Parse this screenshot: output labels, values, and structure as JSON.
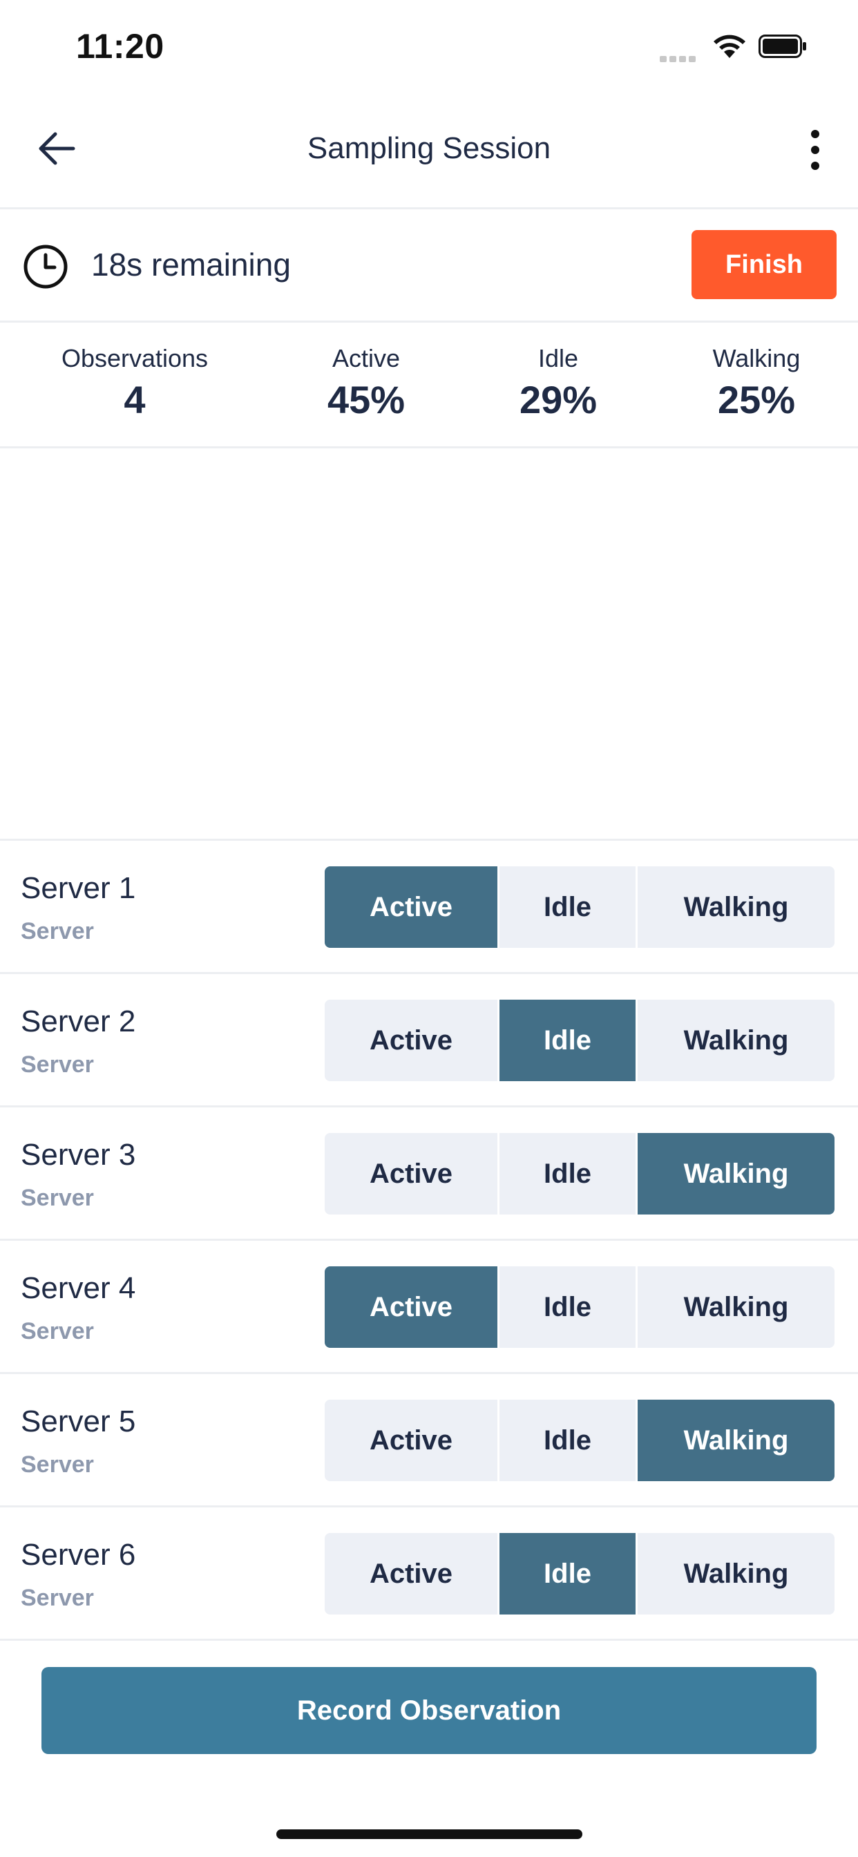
{
  "status_bar": {
    "time": "11:20"
  },
  "nav": {
    "title": "Sampling Session",
    "back_icon": "arrow-left-icon",
    "more_icon": "vertical-dots-icon"
  },
  "timer": {
    "text": "18s remaining",
    "finish_label": "Finish",
    "icon": "clock-icon"
  },
  "stats": [
    {
      "label": "Observations",
      "value": "4"
    },
    {
      "label": "Active",
      "value": "45%"
    },
    {
      "label": "Idle",
      "value": "29%"
    },
    {
      "label": "Walking",
      "value": "25%"
    }
  ],
  "segment_labels": [
    "Active",
    "Idle",
    "Walking"
  ],
  "servers": [
    {
      "name": "Server 1",
      "type": "Server",
      "selected": "Active"
    },
    {
      "name": "Server 2",
      "type": "Server",
      "selected": "Idle"
    },
    {
      "name": "Server 3",
      "type": "Server",
      "selected": "Walking"
    },
    {
      "name": "Server 4",
      "type": "Server",
      "selected": "Active"
    },
    {
      "name": "Server 5",
      "type": "Server",
      "selected": "Walking"
    },
    {
      "name": "Server 6",
      "type": "Server",
      "selected": "Idle"
    }
  ],
  "record_label": "Record Observation",
  "colors": {
    "accent_selected": "#436f87",
    "record_button": "#3d7d9d",
    "finish_button": "#ff5a2c",
    "segment_bg": "#edf0f6",
    "subtitle": "#8d98ad"
  }
}
